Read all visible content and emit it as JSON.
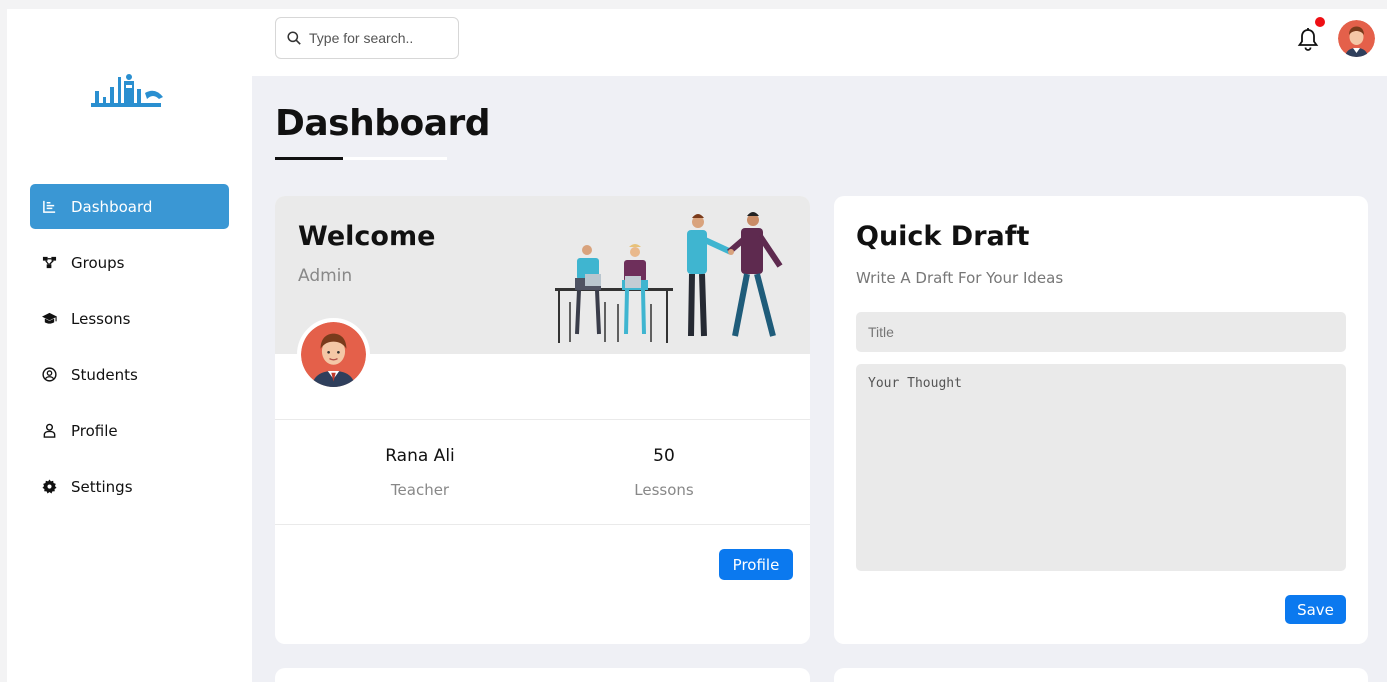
{
  "sidebar": {
    "items": [
      {
        "label": "Dashboard",
        "icon": "chart-icon",
        "active": true
      },
      {
        "label": "Groups",
        "icon": "diagram-icon",
        "active": false
      },
      {
        "label": "Lessons",
        "icon": "graduation-cap-icon",
        "active": false
      },
      {
        "label": "Students",
        "icon": "user-circle-icon",
        "active": false
      },
      {
        "label": "Profile",
        "icon": "user-icon",
        "active": false
      },
      {
        "label": "Settings",
        "icon": "gear-icon",
        "active": false
      }
    ]
  },
  "header": {
    "search_placeholder": "Type for search..",
    "has_notification": true
  },
  "page": {
    "title": "Dashboard"
  },
  "welcome": {
    "title": "Welcome",
    "subtitle": "Admin",
    "name": "Rana Ali",
    "role": "Teacher",
    "lessons_count": "50",
    "lessons_label": "Lessons",
    "button_label": "Profile"
  },
  "draft": {
    "title": "Quick Draft",
    "subtitle": "Write A Draft For Your Ideas",
    "title_placeholder": "Title",
    "body_placeholder": "Your Thought",
    "button_label": "Save"
  },
  "colors": {
    "accent": "#3a97d4",
    "button": "#0b79ef",
    "notification": "#ee0f14",
    "avatar_bg": "#e4604a"
  }
}
